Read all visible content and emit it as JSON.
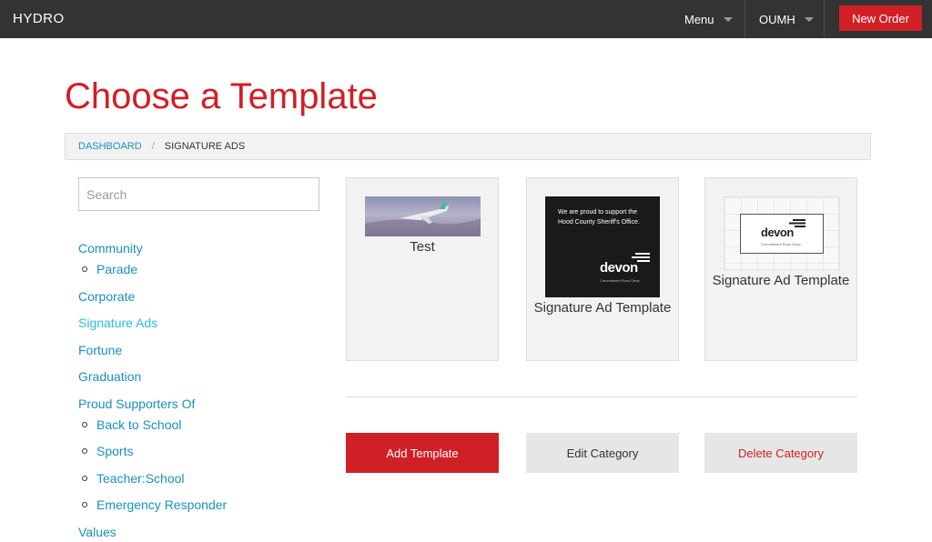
{
  "nav": {
    "brand": "HYDRO",
    "menu_label": "Menu",
    "org_label": "OUMH",
    "new_order_label": "New Order"
  },
  "page": {
    "title": "Choose a Template"
  },
  "breadcrumb": {
    "items": [
      "DASHBOARD",
      "SIGNATURE ADS"
    ],
    "separator": "/"
  },
  "sidebar": {
    "search_placeholder": "Search",
    "categories": [
      {
        "label": "Community",
        "children": [
          "Parade"
        ]
      },
      {
        "label": "Corporate",
        "children": []
      },
      {
        "label": "Signature Ads",
        "active": true,
        "children": []
      },
      {
        "label": "Fortune",
        "children": []
      },
      {
        "label": "Graduation",
        "children": []
      },
      {
        "label": "Proud Supporters Of",
        "children": [
          "Back to School",
          "Sports",
          "Teacher:School",
          "Emergency Responder"
        ]
      },
      {
        "label": "Values",
        "children": []
      }
    ]
  },
  "templates": [
    {
      "name": "Test",
      "thumbnail": "airplane-photo"
    },
    {
      "name": "Signature Ad Template",
      "thumbnail": "devon-dark-ad",
      "thumb_text": "We are proud to support the Hood County Sheriff's Office.",
      "logo": "devon",
      "logo_tagline": "Commitment Runs Deep"
    },
    {
      "name": "Signature Ad Template",
      "thumbnail": "devon-white-ad",
      "logo": "devon",
      "logo_tagline": "Commitment Runs Deep"
    }
  ],
  "actions": {
    "add_template": "Add Template",
    "edit_category": "Edit Category",
    "delete_category": "Delete Category"
  },
  "colors": {
    "brand_red": "#d11f26",
    "link_blue": "#1a8fc1",
    "active_link": "#2bbde0",
    "topbar": "#333333"
  }
}
